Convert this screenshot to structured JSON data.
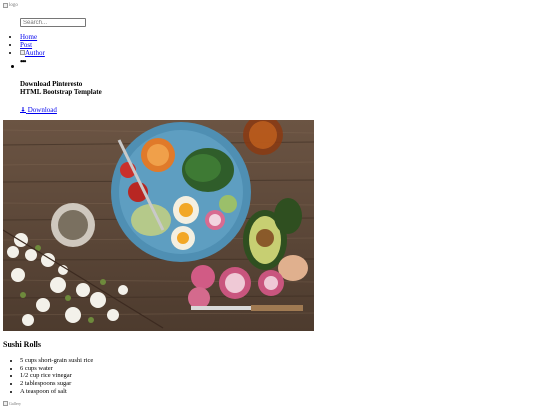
{
  "header": {
    "logo_alt": "logo",
    "search_placeholder": "Search..."
  },
  "nav": {
    "items": [
      {
        "label": "Home"
      },
      {
        "label": "Post"
      },
      {
        "label": "Author"
      }
    ],
    "more_label": "•••"
  },
  "dropdown": {
    "title_line1": "Download Pinteresto",
    "title_line2": "HTML Bootstrap Template",
    "download_label": "Download",
    "download_icon": "download-icon"
  },
  "post": {
    "title": "Sushi Rolls",
    "ingredients": [
      "5 cups short-grain sushi rice",
      "6 cups water",
      "1/2 cup rice vinegar",
      "2 tablespoons sugar",
      "A teaspoon of salt"
    ]
  },
  "footer": {
    "image_alt": "Gallery"
  }
}
